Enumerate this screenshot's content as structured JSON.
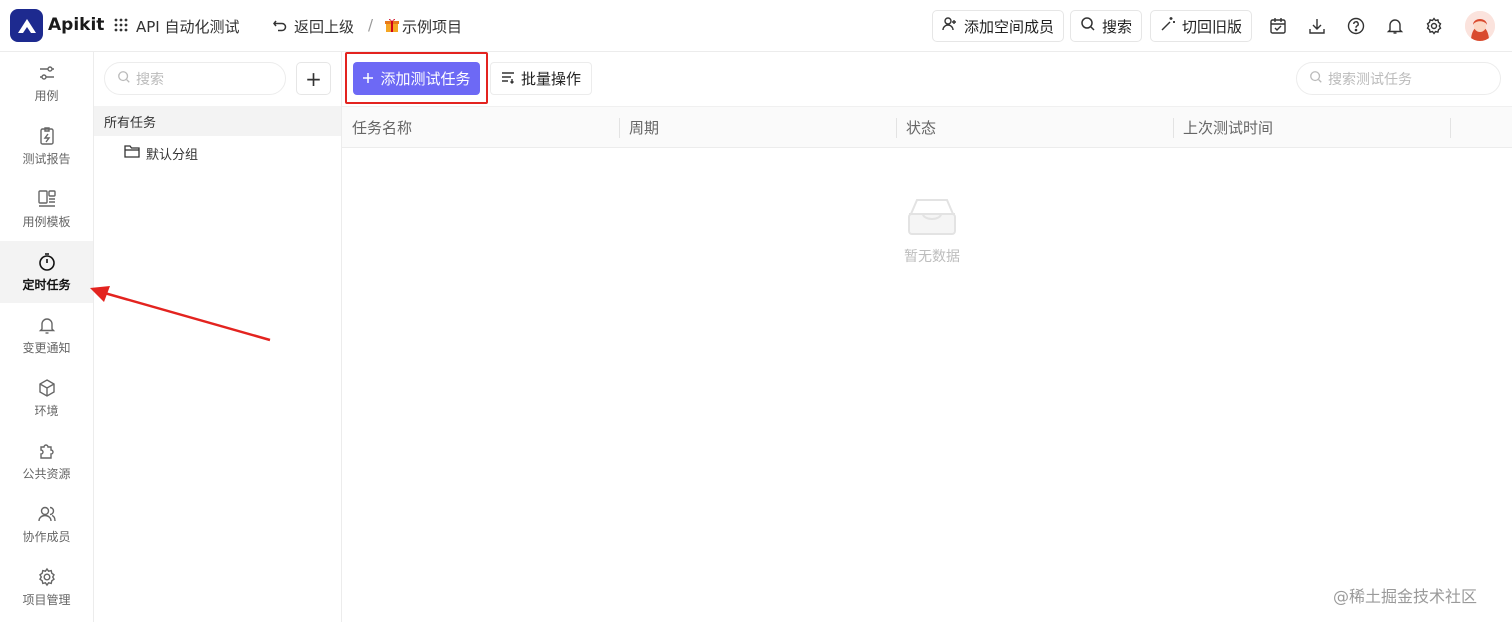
{
  "header": {
    "brand": "Apikit",
    "app_name": "API 自动化测试",
    "back_label": "返回上级",
    "breadcrumb_sep": "/",
    "project_name": "示例项目",
    "add_member_label": "添加空间成员",
    "search_label": "搜索",
    "switch_old_label": "切回旧版"
  },
  "leftnav": {
    "items": [
      {
        "label": "用例",
        "icon": "sliders-icon"
      },
      {
        "label": "测试报告",
        "icon": "report-icon"
      },
      {
        "label": "用例模板",
        "icon": "template-icon"
      },
      {
        "label": "定时任务",
        "icon": "timer-icon",
        "active": true
      },
      {
        "label": "变更通知",
        "icon": "bell-icon"
      },
      {
        "label": "环境",
        "icon": "cube-icon"
      },
      {
        "label": "公共资源",
        "icon": "puzzle-icon"
      },
      {
        "label": "协作成员",
        "icon": "users-icon"
      },
      {
        "label": "项目管理",
        "icon": "gear-icon"
      }
    ]
  },
  "groups": {
    "search_placeholder": "搜索",
    "add_label": "+",
    "all_tasks": "所有任务",
    "default_group": "默认分组"
  },
  "toolbar": {
    "add_task_label": "添加测试任务",
    "batch_label": "批量操作",
    "search_placeholder": "搜索测试任务"
  },
  "table": {
    "columns": [
      "任务名称",
      "周期",
      "状态",
      "上次测试时间"
    ],
    "rows": [],
    "empty_text": "暂无数据"
  },
  "watermark": "@稀土掘金技术社区",
  "colors": {
    "primary": "#6d69f5",
    "brand": "#1d2a8f",
    "highlight": "#e3231f"
  }
}
